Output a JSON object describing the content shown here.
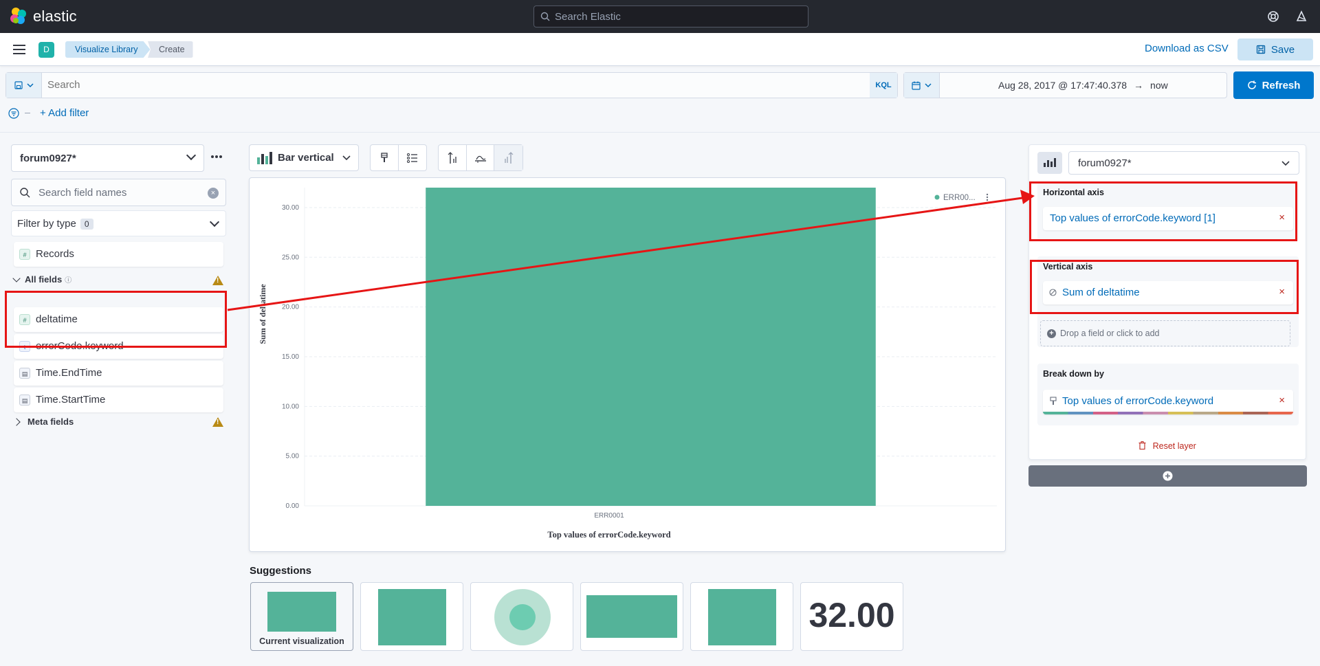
{
  "app": {
    "name": "elastic",
    "search_placeholder": "Search Elastic",
    "space_initial": "D"
  },
  "breadcrumbs": [
    "Visualize Library",
    "Create"
  ],
  "header": {
    "download_csv": "Download as CSV",
    "save": "Save"
  },
  "query": {
    "placeholder": "Search",
    "language": "KQL"
  },
  "time": {
    "start": "Aug 28, 2017 @ 17:47:40.378",
    "arrow": "→",
    "end": "now",
    "refresh": "Refresh"
  },
  "filters": {
    "add_filter": "+ Add filter"
  },
  "left_panel": {
    "index_pattern": "forum0927*",
    "field_search_placeholder": "Search field names",
    "filter_by_type": "Filter by type",
    "filter_count": "0",
    "records": "Records",
    "all_fields_label": "All fields",
    "fields": [
      {
        "name": "deltatime",
        "type": "#"
      },
      {
        "name": "errorCode.keyword",
        "type": "t"
      },
      {
        "name": "Time.EndTime",
        "type": "date"
      },
      {
        "name": "Time.StartTime",
        "type": "date"
      }
    ],
    "meta_fields_label": "Meta fields"
  },
  "toolbar": {
    "chart_type": "Bar vertical"
  },
  "chart_data": {
    "type": "bar",
    "categories": [
      "ERR0001"
    ],
    "values": [
      32
    ],
    "xlabel": "Top values of errorCode.keyword",
    "ylabel": "Sum of deltatime",
    "ylim": [
      0,
      32
    ],
    "yticks": [
      "0.00",
      "5.00",
      "10.00",
      "15.00",
      "20.00",
      "25.00",
      "30.00"
    ],
    "legend": [
      {
        "name": "ERR00...",
        "color": "#54b399"
      }
    ],
    "legend_position": "top-right",
    "bar_color": "#54b399",
    "grid": true
  },
  "suggestions": {
    "title": "Suggestions",
    "current_label": "Current visualization",
    "metric_value": "32.00"
  },
  "right_panel": {
    "index_pattern": "forum0927*",
    "horizontal_axis": {
      "title": "Horizontal axis",
      "value": "Top values of errorCode.keyword [1]"
    },
    "vertical_axis": {
      "title": "Vertical axis",
      "value": "Sum of deltatime"
    },
    "drop_hint": "Drop a field or click to add",
    "breakdown": {
      "title": "Break down by",
      "value": "Top values of errorCode.keyword"
    },
    "reset_layer": "Reset layer"
  },
  "colors": {
    "accent": "#0077cc",
    "bar": "#54b399",
    "annotation": "#e61515",
    "danger": "#bd271e"
  }
}
